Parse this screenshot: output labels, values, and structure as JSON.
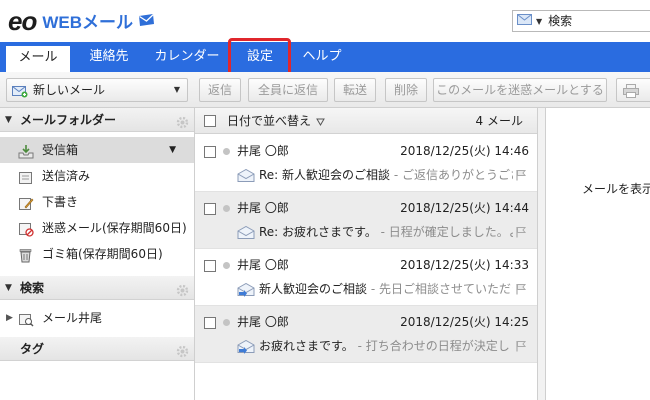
{
  "header": {
    "logo_brand": "eo",
    "logo_product": "WEBメール",
    "search_placeholder": "検索"
  },
  "tabs": [
    {
      "label": "メール",
      "active": true
    },
    {
      "label": "連絡先"
    },
    {
      "label": "カレンダー"
    },
    {
      "label": "設定",
      "highlighted": true
    },
    {
      "label": "ヘルプ"
    }
  ],
  "toolbar": {
    "new_mail": "新しいメール",
    "reply": "返信",
    "reply_all": "全員に返信",
    "forward": "転送",
    "delete": "削除",
    "mark_spam": "このメールを迷惑メールとする"
  },
  "sidebar": {
    "folders_title": "メールフォルダー",
    "folders": [
      {
        "label": "受信箱",
        "icon": "inbox-icon",
        "active": true
      },
      {
        "label": "送信済み",
        "icon": "sent-icon"
      },
      {
        "label": "下書き",
        "icon": "draft-icon"
      },
      {
        "label": "迷惑メール(保存期間60日)",
        "icon": "spam-icon"
      },
      {
        "label": "ゴミ箱(保存期間60日)",
        "icon": "trash-icon"
      }
    ],
    "search_title": "検索",
    "search_items": [
      {
        "label": "メール井尾"
      }
    ],
    "tags_title": "タグ"
  },
  "mail_list": {
    "sort_label": "日付で並べ替え",
    "count": "4 メール",
    "messages": [
      {
        "sender": "井尾 〇郎",
        "date": "2018/12/25(火) 14:46",
        "subject": "Re: 新人歓迎会のご相談",
        "preview": " - ご返信ありがとうござい",
        "icon": "envelope-open-icon"
      },
      {
        "sender": "井尾 〇郎",
        "date": "2018/12/25(火) 14:44",
        "subject": "Re: お疲れさまです。",
        "preview": " - 日程が確定しました。よろし",
        "icon": "envelope-open-icon"
      },
      {
        "sender": "井尾 〇郎",
        "date": "2018/12/25(火) 14:33",
        "subject": "新人歓迎会のご相談",
        "preview": " - 先日ご相談させていただき",
        "icon": "envelope-sent-icon"
      },
      {
        "sender": "井尾 〇郎",
        "date": "2018/12/25(火) 14:25",
        "subject": "お疲れさまです。",
        "preview": " - 打ち合わせの日程が決定し",
        "icon": "envelope-sent-icon"
      }
    ]
  },
  "preview_pane": {
    "message": "メールを表示"
  },
  "colors": {
    "tabbar": "#2a6ce0",
    "highlight": "#e0262c",
    "logo_blue": "#2f6fd8"
  }
}
